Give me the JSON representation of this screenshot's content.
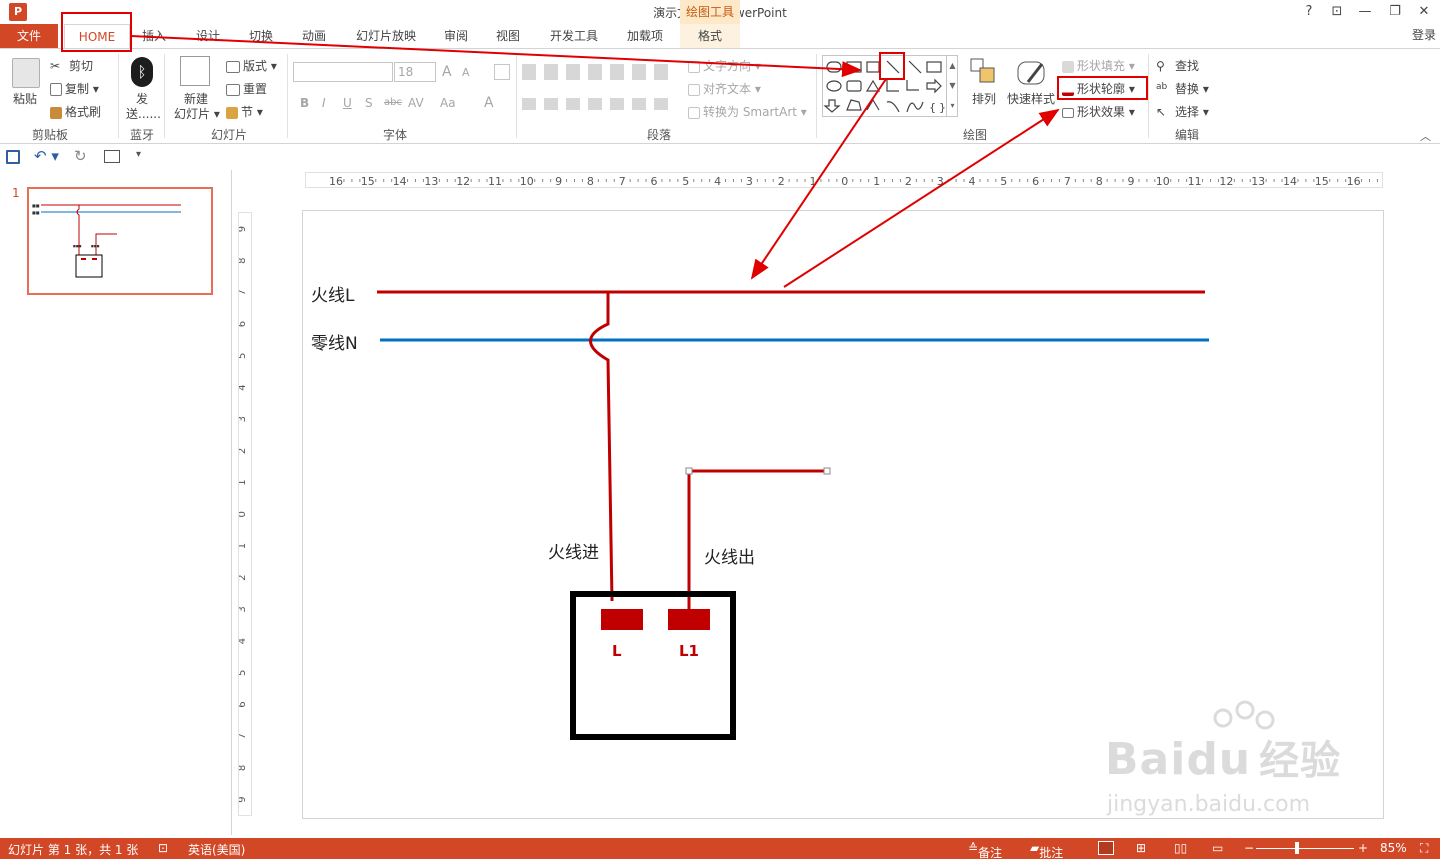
{
  "title_bar": {
    "app_icon": "P",
    "title": "演示文稿1 - PowerPoint",
    "help": "?",
    "ribbon_opts": "⊡",
    "minimize": "—",
    "restore": "❐",
    "close": "✕"
  },
  "tabs": [
    {
      "label": "文件"
    },
    {
      "label": "HOME"
    },
    {
      "label": "插入"
    },
    {
      "label": "设计"
    },
    {
      "label": "切换"
    },
    {
      "label": "动画"
    },
    {
      "label": "幻灯片放映"
    },
    {
      "label": "审阅"
    },
    {
      "label": "视图"
    },
    {
      "label": "开发工具"
    },
    {
      "label": "加载项"
    },
    {
      "label": "格式"
    }
  ],
  "context_header": "绘图工具",
  "signin": "登录",
  "ribbon": {
    "clipboard": {
      "paste": "粘贴",
      "cut": "剪切",
      "copy": "复制",
      "format_painter": "格式刷",
      "label": "剪贴板"
    },
    "bluetooth": {
      "send1": "发",
      "send2": "送......",
      "label": "蓝牙"
    },
    "slides": {
      "new1": "新建",
      "new2": "幻灯片",
      "layout": "版式",
      "reset": "重置",
      "section": "节",
      "label": "幻灯片"
    },
    "font": {
      "size": "18",
      "label": "字体",
      "bold": "B",
      "italic": "I",
      "underline": "U",
      "shadow": "S",
      "strike": "abc",
      "spacing": "AV",
      "case": "Aa",
      "grow": "A",
      "shrink": "A",
      "color": "A"
    },
    "paragraph": {
      "text_dir": "文字方向",
      "align_text": "对齐文本",
      "smartart": "转换为 SmartArt",
      "label": "段落"
    },
    "drawing": {
      "arrange": "排列",
      "quick_styles": "快速样式",
      "fill": "形状填充",
      "outline": "形状轮廓",
      "effects": "形状效果",
      "label": "绘图"
    },
    "editing": {
      "find": "查找",
      "replace": "替换",
      "select": "选择",
      "label": "编辑"
    }
  },
  "ruler_h": [
    "16",
    "15",
    "14",
    "13",
    "12",
    "11",
    "10",
    "9",
    "8",
    "7",
    "6",
    "5",
    "4",
    "3",
    "2",
    "1",
    "0",
    "1",
    "2",
    "3",
    "4",
    "5",
    "6",
    "7",
    "8",
    "9",
    "10",
    "11",
    "12",
    "13",
    "14",
    "15",
    "16"
  ],
  "ruler_v": [
    "9",
    "8",
    "7",
    "6",
    "5",
    "4",
    "3",
    "2",
    "1",
    "0",
    "1",
    "2",
    "3",
    "4",
    "5",
    "6",
    "7",
    "8",
    "9"
  ],
  "slide_panel": {
    "number": "1"
  },
  "slide": {
    "live_label": "火线L",
    "neutral_label": "零线N",
    "live_in_label": "火线进",
    "live_out_label": "火线出",
    "terminal_l": "L",
    "terminal_l1": "L1",
    "colors": {
      "live": "#c00000",
      "neutral": "#0070c0",
      "box": "#000000"
    }
  },
  "status": {
    "slide_info": "幻灯片 第 1 张，共 1 张",
    "language": "英语(美国)",
    "notes": "备注",
    "comments": "批注",
    "zoom": "85%"
  },
  "watermark": {
    "brand1": "Bai",
    "brand2": "du",
    "brand3": "经验",
    "url": "jingyan.baidu.com"
  }
}
